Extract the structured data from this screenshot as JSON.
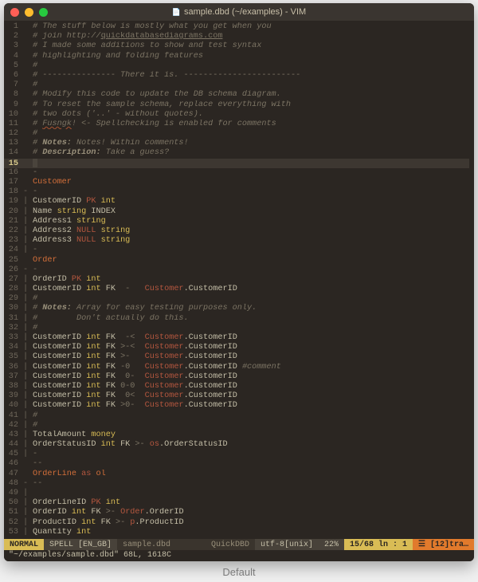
{
  "window": {
    "title": "sample.dbd (~/examples) - VIM"
  },
  "lines": [
    {
      "n": 1,
      "fold": "",
      "cls": "",
      "tokens": [
        [
          "c-comment",
          "# The stuff below is mostly what you get when you"
        ]
      ]
    },
    {
      "n": 2,
      "fold": "",
      "cls": "",
      "tokens": [
        [
          "c-comment",
          "# join http://"
        ],
        [
          "c-url",
          "quickdatabasediagrams.com"
        ]
      ]
    },
    {
      "n": 3,
      "fold": "",
      "cls": "",
      "tokens": [
        [
          "c-comment",
          "# I made some additions to show and test syntax"
        ]
      ]
    },
    {
      "n": 4,
      "fold": "",
      "cls": "",
      "tokens": [
        [
          "c-comment",
          "# highlighting and folding features"
        ]
      ]
    },
    {
      "n": 5,
      "fold": "",
      "cls": "",
      "tokens": [
        [
          "c-comment",
          "#"
        ]
      ]
    },
    {
      "n": 6,
      "fold": "",
      "cls": "",
      "tokens": [
        [
          "c-comment",
          "# "
        ],
        [
          "c-dash",
          "---------------"
        ],
        [
          "c-comment",
          " There it is. "
        ],
        [
          "c-dash",
          "------------------------"
        ]
      ]
    },
    {
      "n": 7,
      "fold": "",
      "cls": "",
      "tokens": [
        [
          "c-comment",
          "#"
        ]
      ]
    },
    {
      "n": 8,
      "fold": "",
      "cls": "",
      "tokens": [
        [
          "c-comment",
          "# Modify this code to update the DB schema diagram."
        ]
      ]
    },
    {
      "n": 9,
      "fold": "",
      "cls": "",
      "tokens": [
        [
          "c-comment",
          "# To reset the sample schema, replace everything with"
        ]
      ]
    },
    {
      "n": 10,
      "fold": "",
      "cls": "",
      "tokens": [
        [
          "c-comment",
          "# two dots ('..' - without quotes)."
        ]
      ]
    },
    {
      "n": 11,
      "fold": "",
      "cls": "",
      "tokens": [
        [
          "c-comment",
          "# "
        ],
        [
          "c-spell",
          "Fusngk"
        ],
        [
          "c-comment",
          "! <- Spellchecking is enabled for comments"
        ]
      ]
    },
    {
      "n": 12,
      "fold": "",
      "cls": "",
      "tokens": [
        [
          "c-comment",
          "#"
        ]
      ]
    },
    {
      "n": 13,
      "fold": "",
      "cls": "",
      "tokens": [
        [
          "c-comment",
          "# "
        ],
        [
          "c-note",
          "Notes:"
        ],
        [
          "c-comment",
          " Notes! Within comments!"
        ]
      ]
    },
    {
      "n": 14,
      "fold": "",
      "cls": "",
      "tokens": [
        [
          "c-comment",
          "# "
        ],
        [
          "c-note",
          "Description:"
        ],
        [
          "c-comment",
          " Take a guess?"
        ]
      ]
    },
    {
      "n": 15,
      "fold": "",
      "cls": "hl",
      "cursor": true,
      "tokens": []
    },
    {
      "n": 16,
      "fold": "",
      "cls": "",
      "tokens": [
        [
          "c-arrow",
          "-"
        ]
      ]
    },
    {
      "n": 17,
      "fold": "",
      "cls": "",
      "tokens": [
        [
          "c-ent",
          "Customer"
        ]
      ]
    },
    {
      "n": 18,
      "fold": "-",
      "cls": "",
      "tokens": [
        [
          "c-arrow",
          "-"
        ]
      ]
    },
    {
      "n": 19,
      "fold": "|",
      "cls": "",
      "tokens": [
        [
          "c-field",
          "CustomerID "
        ],
        [
          "c-null",
          "PK "
        ],
        [
          "c-type",
          "int"
        ]
      ]
    },
    {
      "n": 20,
      "fold": "|",
      "cls": "",
      "tokens": [
        [
          "c-field",
          "Name "
        ],
        [
          "c-type",
          "string "
        ],
        [
          "c-field",
          "INDEX"
        ]
      ]
    },
    {
      "n": 21,
      "fold": "|",
      "cls": "",
      "tokens": [
        [
          "c-field",
          "Address1 "
        ],
        [
          "c-type",
          "string"
        ]
      ]
    },
    {
      "n": 22,
      "fold": "|",
      "cls": "",
      "tokens": [
        [
          "c-field",
          "Address2 "
        ],
        [
          "c-null",
          "NULL "
        ],
        [
          "c-type",
          "string"
        ]
      ]
    },
    {
      "n": 23,
      "fold": "|",
      "cls": "",
      "tokens": [
        [
          "c-field",
          "Address3 "
        ],
        [
          "c-null",
          "NULL "
        ],
        [
          "c-type",
          "string"
        ]
      ]
    },
    {
      "n": 24,
      "fold": "|",
      "cls": "",
      "tokens": [
        [
          "c-arrow",
          "-"
        ]
      ]
    },
    {
      "n": 25,
      "fold": "",
      "cls": "",
      "tokens": [
        [
          "c-ent",
          "Order"
        ]
      ]
    },
    {
      "n": 26,
      "fold": "-",
      "cls": "",
      "tokens": [
        [
          "c-arrow",
          "-"
        ]
      ]
    },
    {
      "n": 27,
      "fold": "|",
      "cls": "",
      "tokens": [
        [
          "c-field",
          "OrderID "
        ],
        [
          "c-null",
          "PK "
        ],
        [
          "c-type",
          "int"
        ]
      ]
    },
    {
      "n": 28,
      "fold": "|",
      "cls": "",
      "tokens": [
        [
          "c-field",
          "CustomerID "
        ],
        [
          "c-type",
          "int "
        ],
        [
          "c-fk",
          "FK "
        ],
        [
          "c-arrow",
          " -   "
        ],
        [
          "c-ref",
          "Customer"
        ],
        [
          "c-refcol",
          ".CustomerID"
        ]
      ]
    },
    {
      "n": 29,
      "fold": "|",
      "cls": "",
      "tokens": [
        [
          "c-comment",
          "#"
        ]
      ]
    },
    {
      "n": 30,
      "fold": "|",
      "cls": "",
      "tokens": [
        [
          "c-comment",
          "# "
        ],
        [
          "c-note",
          "Notes:"
        ],
        [
          "c-comment",
          " Array for easy testing purposes only."
        ]
      ]
    },
    {
      "n": 31,
      "fold": "|",
      "cls": "",
      "tokens": [
        [
          "c-comment",
          "#        Don't actually do this."
        ]
      ]
    },
    {
      "n": 32,
      "fold": "|",
      "cls": "",
      "tokens": [
        [
          "c-comment",
          "#"
        ]
      ]
    },
    {
      "n": 33,
      "fold": "|",
      "cls": "",
      "tokens": [
        [
          "c-field",
          "CustomerID "
        ],
        [
          "c-type",
          "int "
        ],
        [
          "c-fk",
          "FK "
        ],
        [
          "c-arrow",
          " -<  "
        ],
        [
          "c-ref",
          "Customer"
        ],
        [
          "c-refcol",
          ".CustomerID"
        ]
      ]
    },
    {
      "n": 34,
      "fold": "|",
      "cls": "",
      "tokens": [
        [
          "c-field",
          "CustomerID "
        ],
        [
          "c-type",
          "int "
        ],
        [
          "c-fk",
          "FK "
        ],
        [
          "c-arrow",
          ">-<  "
        ],
        [
          "c-ref",
          "Customer"
        ],
        [
          "c-refcol",
          ".CustomerID"
        ]
      ]
    },
    {
      "n": 35,
      "fold": "|",
      "cls": "",
      "tokens": [
        [
          "c-field",
          "CustomerID "
        ],
        [
          "c-type",
          "int "
        ],
        [
          "c-fk",
          "FK "
        ],
        [
          "c-arrow",
          ">-   "
        ],
        [
          "c-ref",
          "Customer"
        ],
        [
          "c-refcol",
          ".CustomerID"
        ]
      ]
    },
    {
      "n": 36,
      "fold": "|",
      "cls": "",
      "tokens": [
        [
          "c-field",
          "CustomerID "
        ],
        [
          "c-type",
          "int "
        ],
        [
          "c-fk",
          "FK "
        ],
        [
          "c-arrow",
          "-0   "
        ],
        [
          "c-ref",
          "Customer"
        ],
        [
          "c-refcol",
          ".CustomerID "
        ],
        [
          "c-comment",
          "#comment"
        ]
      ]
    },
    {
      "n": 37,
      "fold": "|",
      "cls": "",
      "tokens": [
        [
          "c-field",
          "CustomerID "
        ],
        [
          "c-type",
          "int "
        ],
        [
          "c-fk",
          "FK "
        ],
        [
          "c-arrow",
          " 0-  "
        ],
        [
          "c-ref",
          "Customer"
        ],
        [
          "c-refcol",
          ".CustomerID"
        ]
      ]
    },
    {
      "n": 38,
      "fold": "|",
      "cls": "",
      "tokens": [
        [
          "c-field",
          "CustomerID "
        ],
        [
          "c-type",
          "int "
        ],
        [
          "c-fk",
          "FK "
        ],
        [
          "c-arrow",
          "0-0  "
        ],
        [
          "c-ref",
          "Customer"
        ],
        [
          "c-refcol",
          ".CustomerID"
        ]
      ]
    },
    {
      "n": 39,
      "fold": "|",
      "cls": "",
      "tokens": [
        [
          "c-field",
          "CustomerID "
        ],
        [
          "c-type",
          "int "
        ],
        [
          "c-fk",
          "FK "
        ],
        [
          "c-arrow",
          " 0<  "
        ],
        [
          "c-ref",
          "Customer"
        ],
        [
          "c-refcol",
          ".CustomerID"
        ]
      ]
    },
    {
      "n": 40,
      "fold": "|",
      "cls": "",
      "tokens": [
        [
          "c-field",
          "CustomerID "
        ],
        [
          "c-type",
          "int "
        ],
        [
          "c-fk",
          "FK "
        ],
        [
          "c-arrow",
          ">0-  "
        ],
        [
          "c-ref",
          "Customer"
        ],
        [
          "c-refcol",
          ".CustomerID"
        ]
      ]
    },
    {
      "n": 41,
      "fold": "|",
      "cls": "",
      "tokens": [
        [
          "c-comment",
          "#"
        ]
      ]
    },
    {
      "n": 42,
      "fold": "|",
      "cls": "",
      "tokens": [
        [
          "c-comment",
          "#"
        ]
      ]
    },
    {
      "n": 43,
      "fold": "|",
      "cls": "",
      "tokens": [
        [
          "c-field",
          "TotalAmount "
        ],
        [
          "c-type",
          "money"
        ]
      ]
    },
    {
      "n": 44,
      "fold": "|",
      "cls": "",
      "tokens": [
        [
          "c-field",
          "OrderStatusID "
        ],
        [
          "c-type",
          "int "
        ],
        [
          "c-fk",
          "FK "
        ],
        [
          "c-arrow",
          ">- "
        ],
        [
          "c-ref",
          "os"
        ],
        [
          "c-refcol",
          ".OrderStatusID"
        ]
      ]
    },
    {
      "n": 45,
      "fold": "|",
      "cls": "",
      "tokens": [
        [
          "c-arrow",
          "-"
        ]
      ]
    },
    {
      "n": 46,
      "fold": "",
      "cls": "",
      "tokens": [
        [
          "c-arrow",
          "--"
        ]
      ]
    },
    {
      "n": 47,
      "fold": "",
      "cls": "",
      "tokens": [
        [
          "c-ent",
          "OrderLine "
        ],
        [
          "c-kw",
          "as "
        ],
        [
          "c-alias",
          "ol"
        ]
      ]
    },
    {
      "n": 48,
      "fold": "-",
      "cls": "",
      "tokens": [
        [
          "c-arrow",
          "--"
        ]
      ]
    },
    {
      "n": 49,
      "fold": "|",
      "cls": "",
      "tokens": []
    },
    {
      "n": 50,
      "fold": "|",
      "cls": "",
      "tokens": [
        [
          "c-field",
          "OrderLineID "
        ],
        [
          "c-null",
          "PK "
        ],
        [
          "c-type",
          "int"
        ]
      ]
    },
    {
      "n": 51,
      "fold": "|",
      "cls": "",
      "tokens": [
        [
          "c-field",
          "OrderID "
        ],
        [
          "c-type",
          "int "
        ],
        [
          "c-fk",
          "FK "
        ],
        [
          "c-arrow",
          ">- "
        ],
        [
          "c-ref",
          "Order"
        ],
        [
          "c-refcol",
          ".OrderID"
        ]
      ]
    },
    {
      "n": 52,
      "fold": "|",
      "cls": "",
      "tokens": [
        [
          "c-field",
          "ProductID "
        ],
        [
          "c-type",
          "int "
        ],
        [
          "c-fk",
          "FK "
        ],
        [
          "c-arrow",
          ">- "
        ],
        [
          "c-ref",
          "p"
        ],
        [
          "c-refcol",
          ".ProductID"
        ]
      ]
    },
    {
      "n": 53,
      "fold": "|",
      "cls": "",
      "tokens": [
        [
          "c-field",
          "Quantity "
        ],
        [
          "c-type",
          "int"
        ]
      ]
    }
  ],
  "status": {
    "mode": "NORMAL",
    "spell": "SPELL [EN_GB]",
    "file": "sample.dbd",
    "filetype": "QuickDBD",
    "encoding": "utf-8[unix]",
    "percent": "22%",
    "linecol": "15/68 ln : 1",
    "trail": "☰ [12]tra…"
  },
  "cmdline": "\"~/examples/sample.dbd\" 68L, 1618C",
  "caption": "Default"
}
